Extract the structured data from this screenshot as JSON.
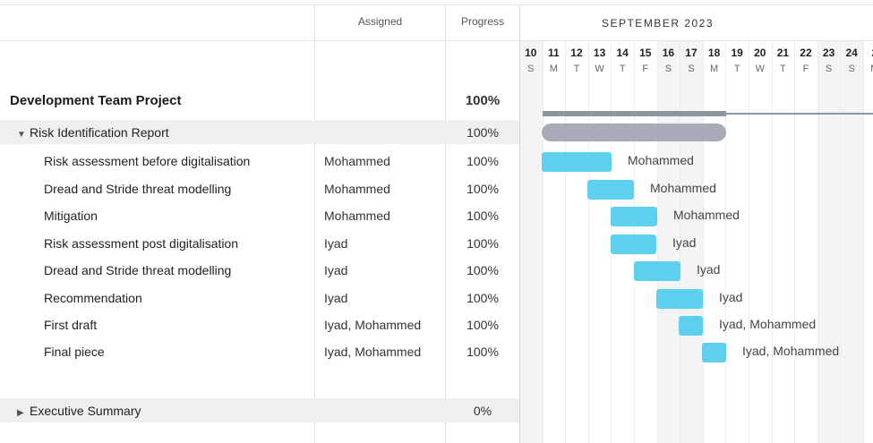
{
  "header": {
    "assigned_label": "Assigned",
    "progress_label": "Progress",
    "month_label": "SEPTEMBER 2023"
  },
  "days": [
    {
      "num": "10",
      "dow": "S"
    },
    {
      "num": "11",
      "dow": "M"
    },
    {
      "num": "12",
      "dow": "T"
    },
    {
      "num": "13",
      "dow": "W"
    },
    {
      "num": "14",
      "dow": "T"
    },
    {
      "num": "15",
      "dow": "F"
    },
    {
      "num": "16",
      "dow": "S"
    },
    {
      "num": "17",
      "dow": "S"
    },
    {
      "num": "18",
      "dow": "M"
    },
    {
      "num": "19",
      "dow": "T"
    },
    {
      "num": "20",
      "dow": "W"
    },
    {
      "num": "21",
      "dow": "T"
    },
    {
      "num": "22",
      "dow": "F"
    },
    {
      "num": "23",
      "dow": "S"
    },
    {
      "num": "24",
      "dow": "S"
    },
    {
      "num": "2",
      "dow": "M"
    }
  ],
  "project": {
    "name": "Development Team Project",
    "progress": "100%"
  },
  "group1": {
    "name": "Risk Identification Report",
    "progress": "100%",
    "caret": "▼",
    "expanded": true
  },
  "tasks": [
    {
      "name": "Risk assessment before digitalisation",
      "assigned": "Mohammed",
      "progress": "100%",
      "bar_label": "Mohammed"
    },
    {
      "name": "Dread and Stride threat modelling",
      "assigned": "Mohammed",
      "progress": "100%",
      "bar_label": "Mohammed"
    },
    {
      "name": "Mitigation",
      "assigned": "Mohammed",
      "progress": "100%",
      "bar_label": "Mohammed"
    },
    {
      "name": "Risk assessment post digitalisation",
      "assigned": "Iyad",
      "progress": "100%",
      "bar_label": "Iyad"
    },
    {
      "name": "Dread and Stride threat modelling",
      "assigned": "Iyad",
      "progress": "100%",
      "bar_label": "Iyad"
    },
    {
      "name": "Recommendation",
      "assigned": "Iyad",
      "progress": "100%",
      "bar_label": "Iyad"
    },
    {
      "name": "First draft",
      "assigned": "Iyad, Mohammed",
      "progress": "100%",
      "bar_label": "Iyad, Mohammed"
    },
    {
      "name": "Final piece",
      "assigned": "Iyad, Mohammed",
      "progress": "100%",
      "bar_label": "Iyad, Mohammed"
    }
  ],
  "group2": {
    "name": "Executive Summary",
    "progress": "0%",
    "caret": "▶",
    "expanded": false
  },
  "colors": {
    "task_bar": "#5fcfee",
    "group_bar": "#a9aab8",
    "project_bar": "#8c96a0",
    "weekend": "#f4f4f4"
  }
}
